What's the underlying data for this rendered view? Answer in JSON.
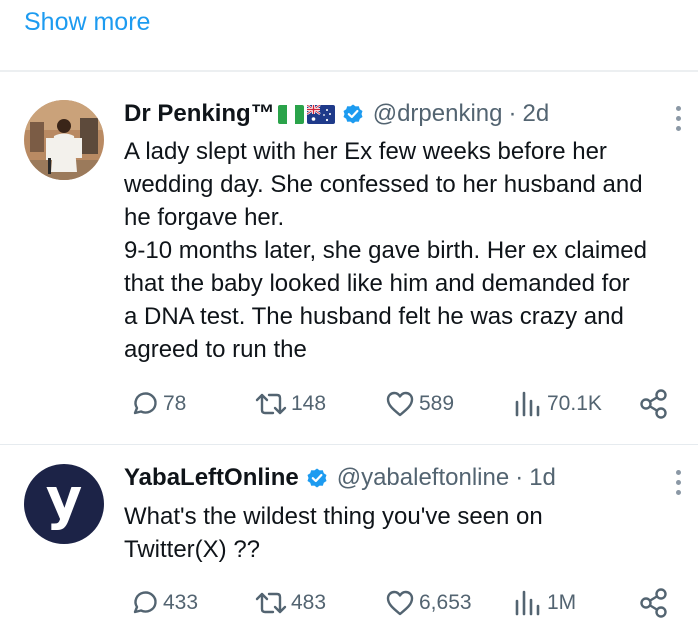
{
  "show_more": "Show more",
  "tweets": [
    {
      "name": "Dr Penking™",
      "handle": "@drpenking",
      "separator": "·",
      "time": "2d",
      "text_lines": [
        "A lady slept with her Ex few weeks before her",
        "wedding day. She confessed to her husband and",
        "he forgave her.",
        "9-10 months later, she gave birth. Her ex claimed",
        "that the baby looked like him and demanded for",
        "a DNA test. The husband felt he was crazy and",
        "agreed to run the"
      ],
      "replies": "78",
      "reposts": "148",
      "likes": "589",
      "views": "70.1K",
      "flags": [
        "nigeria-flag-icon",
        "australia-flag-icon"
      ]
    },
    {
      "name": "YabaLeftOnline",
      "handle": "@yabaleftonline",
      "separator": "·",
      "time": "1d",
      "avatar_letter": "y",
      "text_lines": [
        "What's the wildest thing you've seen on",
        "Twitter(X) ??"
      ],
      "replies": "433",
      "reposts": "483",
      "likes": "6,653",
      "views": "1M"
    }
  ],
  "colors": {
    "accent": "#1d9bf0",
    "text": "#0f1419",
    "muted": "#536471",
    "yaba_avatar_bg": "#1c2347"
  }
}
